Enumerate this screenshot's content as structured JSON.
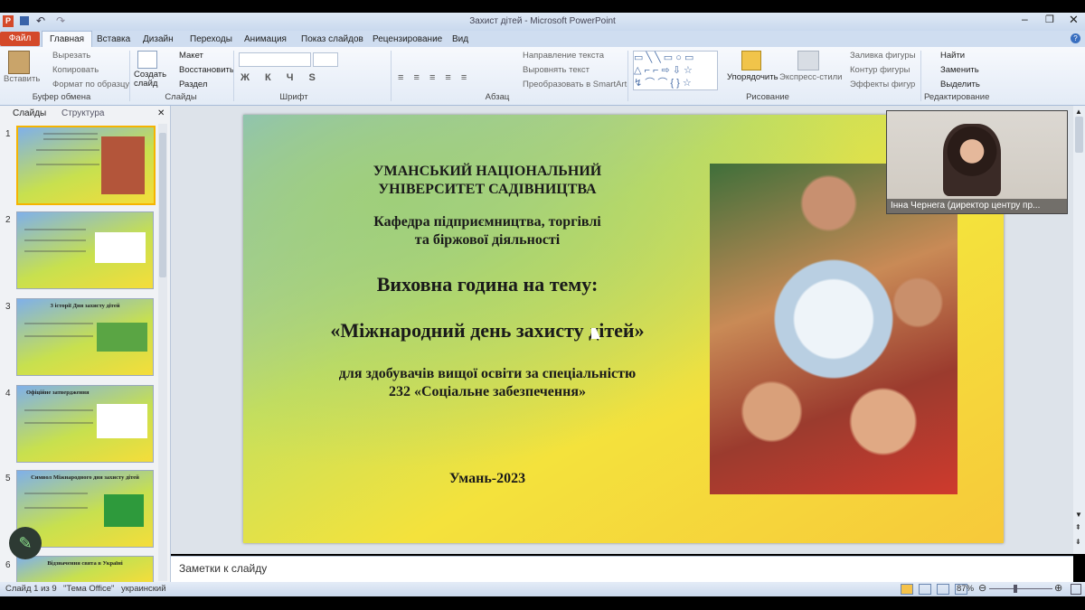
{
  "window": {
    "title": "Захист дітей  -  Microsoft PowerPoint"
  },
  "ribbon_tabs": [
    "Файл",
    "Главная",
    "Вставка",
    "Дизайн",
    "Переходы",
    "Анимация",
    "Показ слайдов",
    "Рецензирование",
    "Вид"
  ],
  "ribbon": {
    "clipboard": {
      "paste": "Вставить",
      "cut": "Вырезать",
      "copy": "Копировать",
      "format": "Формат по образцу",
      "group": "Буфер обмена"
    },
    "slides": {
      "new_slide": "Создать слайд",
      "layout": "Макет",
      "reset": "Восстановить",
      "section": "Раздел",
      "group": "Слайды"
    },
    "font": {
      "group": "Шрифт"
    },
    "paragraph": {
      "direction": "Направление текста",
      "align": "Выровнять текст",
      "smartart": "Преобразовать в SmartArt",
      "group": "Абзац"
    },
    "drawing": {
      "arrange": "Упорядочить",
      "quick_styles": "Экспресс-стили",
      "fill": "Заливка фигуры",
      "outline": "Контур фигуры",
      "effects": "Эффекты фигур",
      "group": "Рисование"
    },
    "editing": {
      "find": "Найти",
      "replace": "Заменить",
      "select": "Выделить",
      "group": "Редактирование"
    }
  },
  "left_panel": {
    "tabs": [
      "Слайды",
      "Структура"
    ],
    "thumbnails": [
      {
        "num": "1",
        "title": ""
      },
      {
        "num": "2",
        "title": ""
      },
      {
        "num": "3",
        "title": "З історії Дня захисту дітей"
      },
      {
        "num": "4",
        "title": "Офіційне затвердження"
      },
      {
        "num": "5",
        "title": "Символ Міжнародного дня захисту дітей"
      },
      {
        "num": "6",
        "title": "Відзначення свята в Україні"
      }
    ]
  },
  "slide": {
    "university_line1": "УМАНСЬКИЙ НАЦІОНАЛЬНИЙ",
    "university_line2": "УНІВЕРСИТЕТ САДІВНИЦТВА",
    "dept_line1": "Кафедра підприємництва, торгівлі",
    "dept_line2": "та біржової діяльності",
    "event": "Виховна година на тему:",
    "topic": "«Міжнародний день захисту дітей»",
    "audience_line1": "для здобувачів вищої освіти за спеціальністю",
    "audience_line2": "232 «Соціальне забезпечення»",
    "place_year": "Умань-2023"
  },
  "webcam": {
    "name": "Інна Чернега (директор центру пр..."
  },
  "notes": {
    "placeholder": "Заметки к слайду"
  },
  "status": {
    "slide": "Слайд 1 из 9",
    "theme": "\"Тема Office\"",
    "lang": "украинский",
    "zoom": "87%"
  },
  "colors": {
    "file_tab": "#d4492a",
    "selection": "#f5b400"
  }
}
